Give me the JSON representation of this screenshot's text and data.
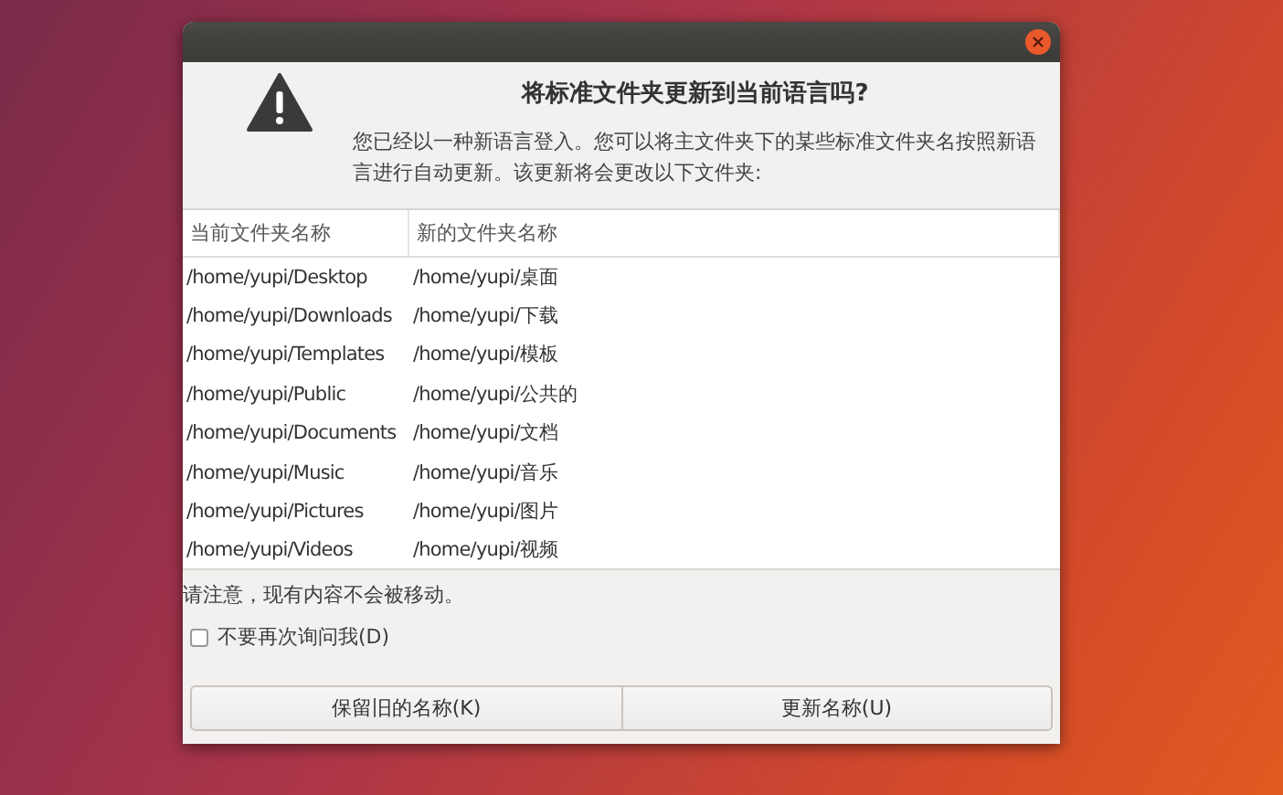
{
  "dialog": {
    "title": "将标准文件夹更新到当前语言吗?",
    "message": "您已经以一种新语言登入。您可以将主文件夹下的某些标准文件夹名按照新语言进行自动更新。该更新将会更改以下文件夹:",
    "table": {
      "columns": [
        "当前文件夹名称",
        "新的文件夹名称"
      ],
      "rows": [
        {
          "current": "/home/yupi/Desktop",
          "new": "/home/yupi/桌面"
        },
        {
          "current": "/home/yupi/Downloads",
          "new": "/home/yupi/下载"
        },
        {
          "current": "/home/yupi/Templates",
          "new": "/home/yupi/模板"
        },
        {
          "current": "/home/yupi/Public",
          "new": "/home/yupi/公共的"
        },
        {
          "current": "/home/yupi/Documents",
          "new": "/home/yupi/文档"
        },
        {
          "current": "/home/yupi/Music",
          "new": "/home/yupi/音乐"
        },
        {
          "current": "/home/yupi/Pictures",
          "new": "/home/yupi/图片"
        },
        {
          "current": "/home/yupi/Videos",
          "new": "/home/yupi/视频"
        }
      ]
    },
    "note": "请注意，现有内容不会被移动。",
    "checkbox": {
      "label": "不要再次询问我(D)",
      "checked": false
    },
    "buttons": [
      "保留旧的名称(K)",
      "更新名称(U)"
    ]
  }
}
